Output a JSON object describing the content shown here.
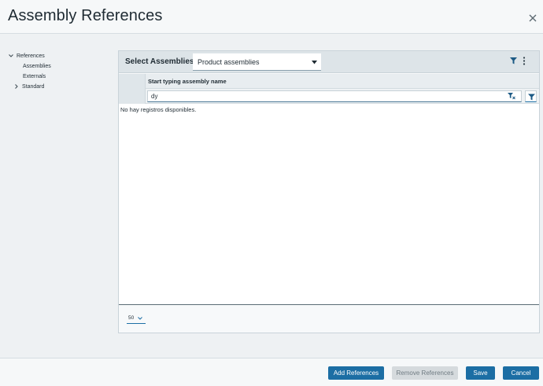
{
  "dialog": {
    "title": "Assembly References"
  },
  "tree": {
    "items": [
      {
        "label": "References",
        "expanded": true
      },
      {
        "label": "Assemblies"
      },
      {
        "label": "Externals"
      },
      {
        "label": "Standard",
        "expanded": false
      }
    ]
  },
  "panel": {
    "title": "Select Assemblies",
    "select_value": "Product assemblies",
    "grid": {
      "column_header": "Start typing assembly name",
      "filter_value": "dy",
      "empty_message": "No hay registros disponibles."
    },
    "page_size": "50"
  },
  "footer": {
    "add_label": "Add References",
    "remove_label": "Remove References",
    "save_label": "Save",
    "cancel_label": "Cancel"
  },
  "colors": {
    "accent": "#1c6ea4",
    "disabled": "#d5dadd"
  }
}
